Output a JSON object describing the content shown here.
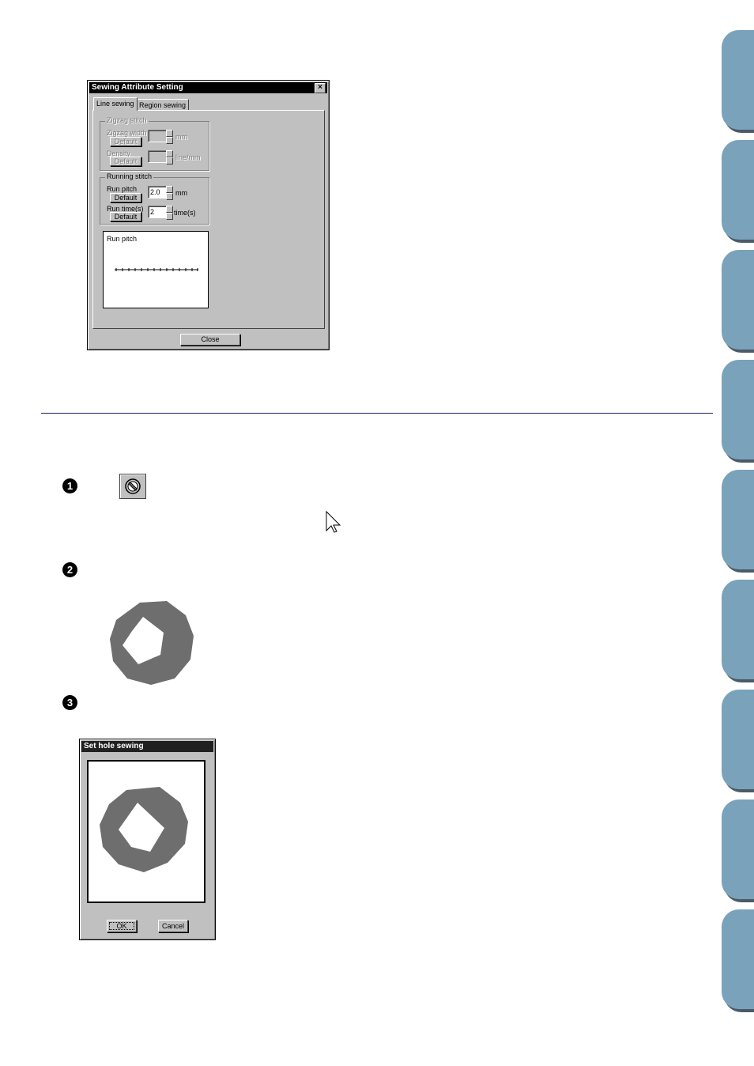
{
  "sewing_dialog": {
    "title": "Sewing Attribute Setting",
    "close_x": "×",
    "tabs": [
      "Line sewing",
      "Region sewing"
    ],
    "zigzag": {
      "group_label": "Zigzag stitch",
      "width_label": "Zigzag width",
      "width_unit": "mm",
      "density_label": "Density",
      "density_unit": "line/mm",
      "default_label": "Default"
    },
    "running": {
      "group_label": "Running stitch",
      "pitch_label": "Run pitch",
      "pitch_value": "2.0",
      "pitch_unit": "mm",
      "times_label": "Run time(s)",
      "times_value": "2",
      "times_unit": "time(s)",
      "default_label": "Default"
    },
    "preview_label": "Run pitch",
    "close_button": "Close"
  },
  "steps": [
    "1",
    "2",
    "3"
  ],
  "icons": {
    "tool_icon": "hole-sewing-tool-icon",
    "cursor_icon": "arrow-cursor-icon"
  },
  "hole_dialog": {
    "title": "Set hole sewing",
    "ok_button": "OK",
    "cancel_button": "Cancel"
  },
  "colors": {
    "divider": "#1a1a6e",
    "side_tab": "#7aa2bb",
    "shape_fill": "#6e6e6e"
  }
}
